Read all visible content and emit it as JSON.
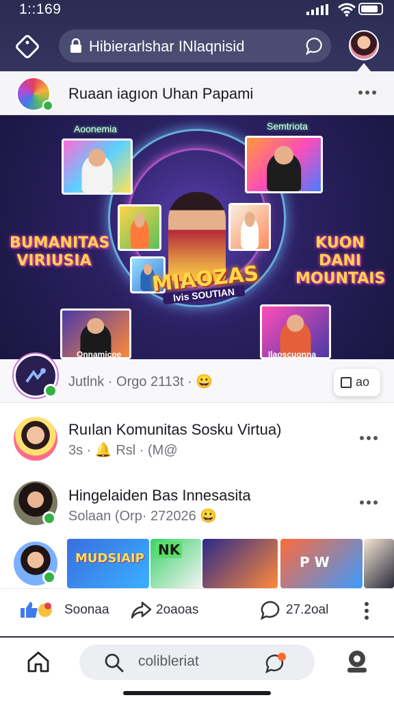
{
  "status_bar": {
    "time": "1::169"
  },
  "browser": {
    "url": "Hibierarlshar INlaqnisid"
  },
  "post": {
    "author": "Ruaan iagıon Uhan Papami",
    "banner": {
      "label_left": "Aoonemia",
      "label_right": "Semtriota",
      "side_left": "BUMANITAS VIRIUSIA",
      "side_right": "KUON DANI MOUNTAIS",
      "center_title": "MIAOZAS",
      "center_sub": "lvis SOUTIAN",
      "bottom_caption_left": "Onnamicoe",
      "bottom_caption_right": "Ilaoscuonna"
    },
    "reaction_text": "Jutlnk · Orgo 2113t · 😀",
    "edit_label": "ao"
  },
  "feed": {
    "items": [
      {
        "name": "Ruılan Komunitas Sosku Virtua)",
        "meta": "3s · 🔔 Rsl · (M@"
      },
      {
        "name": "Hingelaiden Bas Innesasita",
        "meta": "Solaan (Orp· 272026 😀"
      }
    ],
    "strip_tiles": [
      {
        "text": "MUDSIAIP"
      },
      {
        "text": "NK"
      },
      {
        "text": ""
      },
      {
        "text": "P W"
      },
      {
        "text": ""
      }
    ]
  },
  "actions": {
    "like_label": "Soonaa",
    "share_label": "2oaoas",
    "comment_label": "27.2oal"
  },
  "bottom_nav": {
    "search_placeholder": "colibleriat"
  },
  "colors": {
    "header_bg": "#2a2c52",
    "accent_green": "#35b047",
    "like_blue": "#3f7bea",
    "notify_orange": "#ff6a2a"
  },
  "icons": [
    "diamond-nav-icon",
    "lock-icon",
    "chat-bubble-icon",
    "more-dots-icon",
    "edit-icon",
    "like-icon",
    "share-icon",
    "comment-icon",
    "home-icon",
    "search-icon",
    "notification-chat-icon",
    "profile-icon"
  ]
}
